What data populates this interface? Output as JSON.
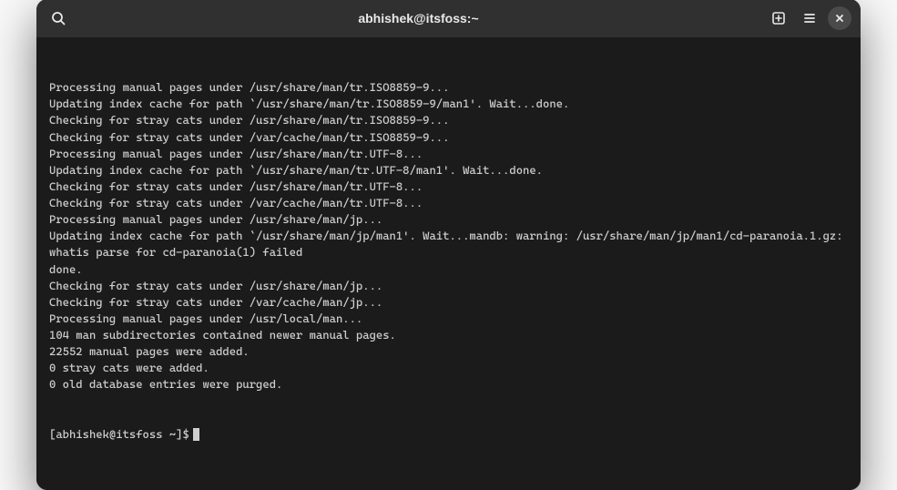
{
  "titlebar": {
    "title": "abhishek@itsfoss:~"
  },
  "terminal": {
    "lines": [
      "Processing manual pages under /usr/share/man/tr.ISO8859-9...",
      "Updating index cache for path `/usr/share/man/tr.ISO8859-9/man1'. Wait...done.",
      "Checking for stray cats under /usr/share/man/tr.ISO8859-9...",
      "Checking for stray cats under /var/cache/man/tr.ISO8859-9...",
      "Processing manual pages under /usr/share/man/tr.UTF-8...",
      "Updating index cache for path `/usr/share/man/tr.UTF-8/man1'. Wait...done.",
      "Checking for stray cats under /usr/share/man/tr.UTF-8...",
      "Checking for stray cats under /var/cache/man/tr.UTF-8...",
      "Processing manual pages under /usr/share/man/jp...",
      "Updating index cache for path `/usr/share/man/jp/man1'. Wait...mandb: warning: /usr/share/man/jp/man1/cd-paranoia.1.gz: whatis parse for cd-paranoia(1) failed",
      "done.",
      "Checking for stray cats under /usr/share/man/jp...",
      "Checking for stray cats under /var/cache/man/jp...",
      "Processing manual pages under /usr/local/man...",
      "104 man subdirectories contained newer manual pages.",
      "22552 manual pages were added.",
      "0 stray cats were added.",
      "0 old database entries were purged."
    ],
    "prompt": "[abhishek@itsfoss ~]$"
  }
}
